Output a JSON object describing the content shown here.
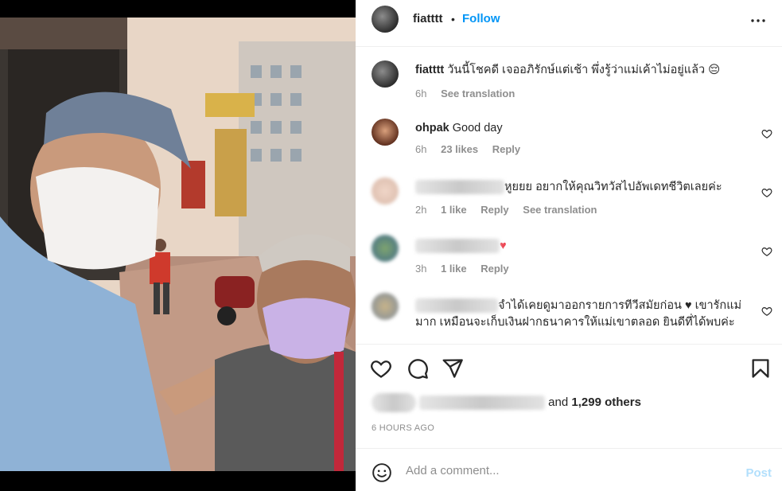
{
  "post": {
    "username": "fiatttt",
    "dot": "•",
    "follow_label": "Follow",
    "caption_user": "fiatttt",
    "caption_text": "วันนี้โชคดี เจออภิรักษ์แต่เช้า พึ่งรู้ว่าแม่เค้าไม่อยู่แล้ว 😔",
    "caption_time": "6h",
    "caption_translate": "See translation"
  },
  "comments": [
    {
      "user": "ohpak",
      "text": "Good day",
      "time": "6h",
      "likes": "23 likes",
      "reply": "Reply"
    },
    {
      "user": "",
      "text": "หูยยย อยากให้คุณวิทวัสไปอัพเดทชีวิตเลยค่ะ",
      "time": "2h",
      "likes": "1 like",
      "reply": "Reply",
      "translate": "See translation"
    },
    {
      "user": "",
      "text": "♥",
      "time": "3h",
      "likes": "1 like",
      "reply": "Reply"
    },
    {
      "user": "",
      "text": "จำได้เคยดูมาออกรายการทีวีสมัยก่อน ♥ เขารักแม่มาก เหมือนจะเก็บเงินฝากธนาคารให้แม่เขาตลอด ยินดีที่ได้พบค่ะ"
    }
  ],
  "likes": {
    "and": "and",
    "others": "1,299 others"
  },
  "timestamp": "6 HOURS AGO",
  "add_comment": {
    "placeholder": "Add a comment...",
    "post_label": "Post"
  },
  "colors": {
    "accent": "#0095f6",
    "post_disabled": "#b2dffc",
    "heart": "#ed4956",
    "text": "#262626",
    "muted": "#8e8e8e"
  },
  "icons": [
    "more-icon",
    "heart-icon",
    "comment-icon",
    "share-icon",
    "bookmark-icon",
    "emoji-icon"
  ]
}
